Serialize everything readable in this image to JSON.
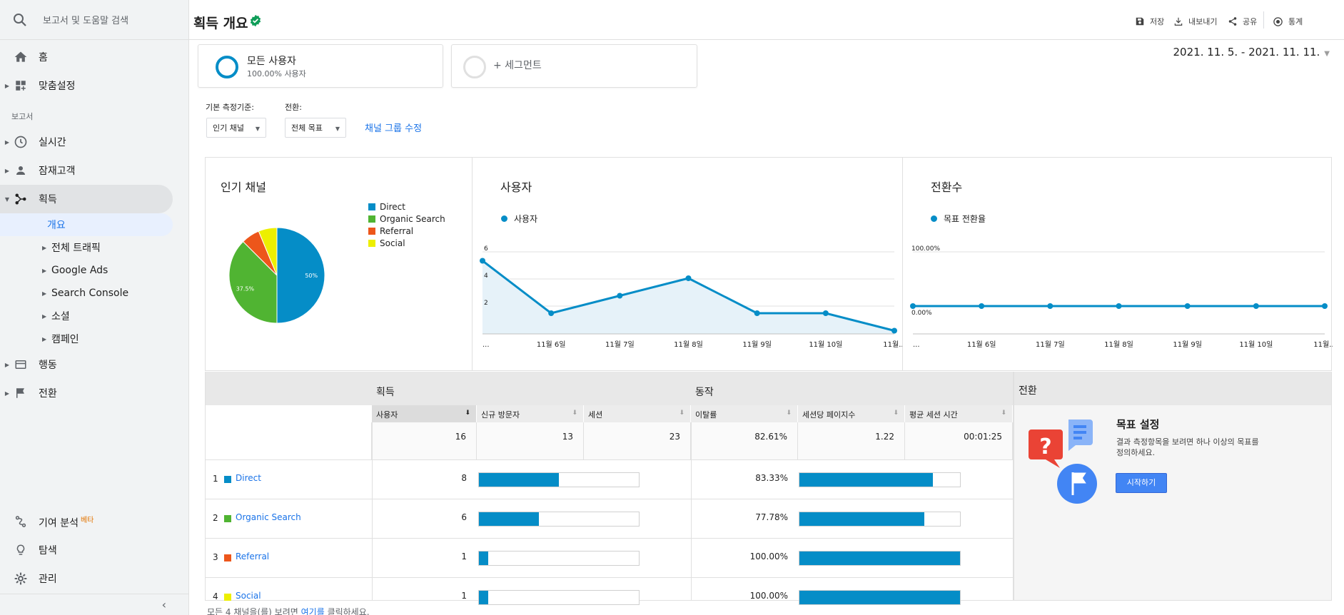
{
  "sidebar": {
    "search_placeholder": "보고서 및 도움말 검색",
    "home": "홈",
    "custom": "맞춤설정",
    "reports_section": "보고서",
    "realtime": "실시간",
    "audience": "잠재고객",
    "acquisition": "획득",
    "acq_sub": {
      "overview": "개요",
      "all_traffic": "전체 트래픽",
      "google_ads": "Google Ads",
      "search_console": "Search Console",
      "social": "소셜",
      "campaigns": "캠페인"
    },
    "behavior": "행동",
    "conversions": "전환",
    "attribution": "기여 분석",
    "beta": "베타",
    "discover": "탐색",
    "admin": "관리"
  },
  "header": {
    "title": "획득 개요",
    "save": "저장",
    "export": "내보내기",
    "share": "공유",
    "insights": "통계"
  },
  "segments": {
    "all_users": "모든 사용자",
    "all_users_pct": "100.00% 사용자",
    "add_segment": "+ 세그먼트"
  },
  "date_range": "2021. 11. 5. - 2021. 11. 11.",
  "filters": {
    "primary_label": "기본 측정기준:",
    "primary_value": "인기 채널",
    "conversion_label": "전환:",
    "conversion_value": "전체 목표",
    "edit_channel_group": "채널 그룹 수정"
  },
  "colors": {
    "direct": "#058dc7",
    "organic": "#50b432",
    "referral": "#ed561b",
    "social": "#edef00",
    "line": "#058dc7"
  },
  "chart_data": [
    {
      "type": "pie",
      "title": "인기 채널",
      "categories": [
        "Direct",
        "Organic Search",
        "Referral",
        "Social"
      ],
      "values": [
        8,
        6,
        1,
        1
      ],
      "labels": [
        "50%",
        "37.5%"
      ]
    },
    {
      "type": "line",
      "title": "사용자",
      "series": [
        {
          "name": "사용자",
          "values": [
            5,
            2,
            3,
            4,
            2,
            2,
            1
          ]
        }
      ],
      "x": [
        "...",
        "11월 6일",
        "11월 7일",
        "11월 8일",
        "11월 9일",
        "11월 10일",
        "11월..."
      ],
      "yticks": [
        "6",
        "4",
        "2"
      ],
      "ylim": [
        0,
        6
      ]
    },
    {
      "type": "line",
      "title": "전환수",
      "series": [
        {
          "name": "목표 전환율",
          "values": [
            0,
            0,
            0,
            0,
            0,
            0,
            0
          ]
        }
      ],
      "x": [
        "...",
        "11월 6일",
        "11월 7일",
        "11월 8일",
        "11월 9일",
        "11월 10일",
        "11월..."
      ],
      "yticks": [
        "100.00%",
        "0.00%"
      ]
    }
  ],
  "table": {
    "group_acquisition": "획득",
    "group_behavior": "동작",
    "group_conversion": "전환",
    "col_users": "사용자",
    "col_new_users": "신규 방문자",
    "col_sessions": "세션",
    "col_bounce": "이탈률",
    "col_pages": "세션당 페이지수",
    "col_duration": "평균 세션 시간",
    "totals": {
      "users": "16",
      "new_users": "13",
      "sessions": "23",
      "bounce": "82.61%",
      "pages": "1.22",
      "duration": "00:01:25"
    },
    "rows": [
      {
        "rank": "1",
        "channel": "Direct",
        "users": "8",
        "new_users_frac": 0.5,
        "bounce": "83.33%",
        "pages_frac": 0.83
      },
      {
        "rank": "2",
        "channel": "Organic Search",
        "users": "6",
        "new_users_frac": 0.375,
        "bounce": "77.78%",
        "pages_frac": 0.778
      },
      {
        "rank": "3",
        "channel": "Referral",
        "users": "1",
        "new_users_frac": 0.06,
        "bounce": "100.00%",
        "pages_frac": 1.0
      },
      {
        "rank": "4",
        "channel": "Social",
        "users": "1",
        "new_users_frac": 0.06,
        "bounce": "100.00%",
        "pages_frac": 1.0
      }
    ]
  },
  "goal": {
    "title": "목표 설정",
    "desc": "결과 측정항목을 보려면 하나 이상의 목표를 정의하세요.",
    "button": "시작하기"
  },
  "footnote": {
    "prefix": "모든 4 채널을(를) 보려면 ",
    "link": "여기를",
    "suffix": " 클릭하세요."
  }
}
